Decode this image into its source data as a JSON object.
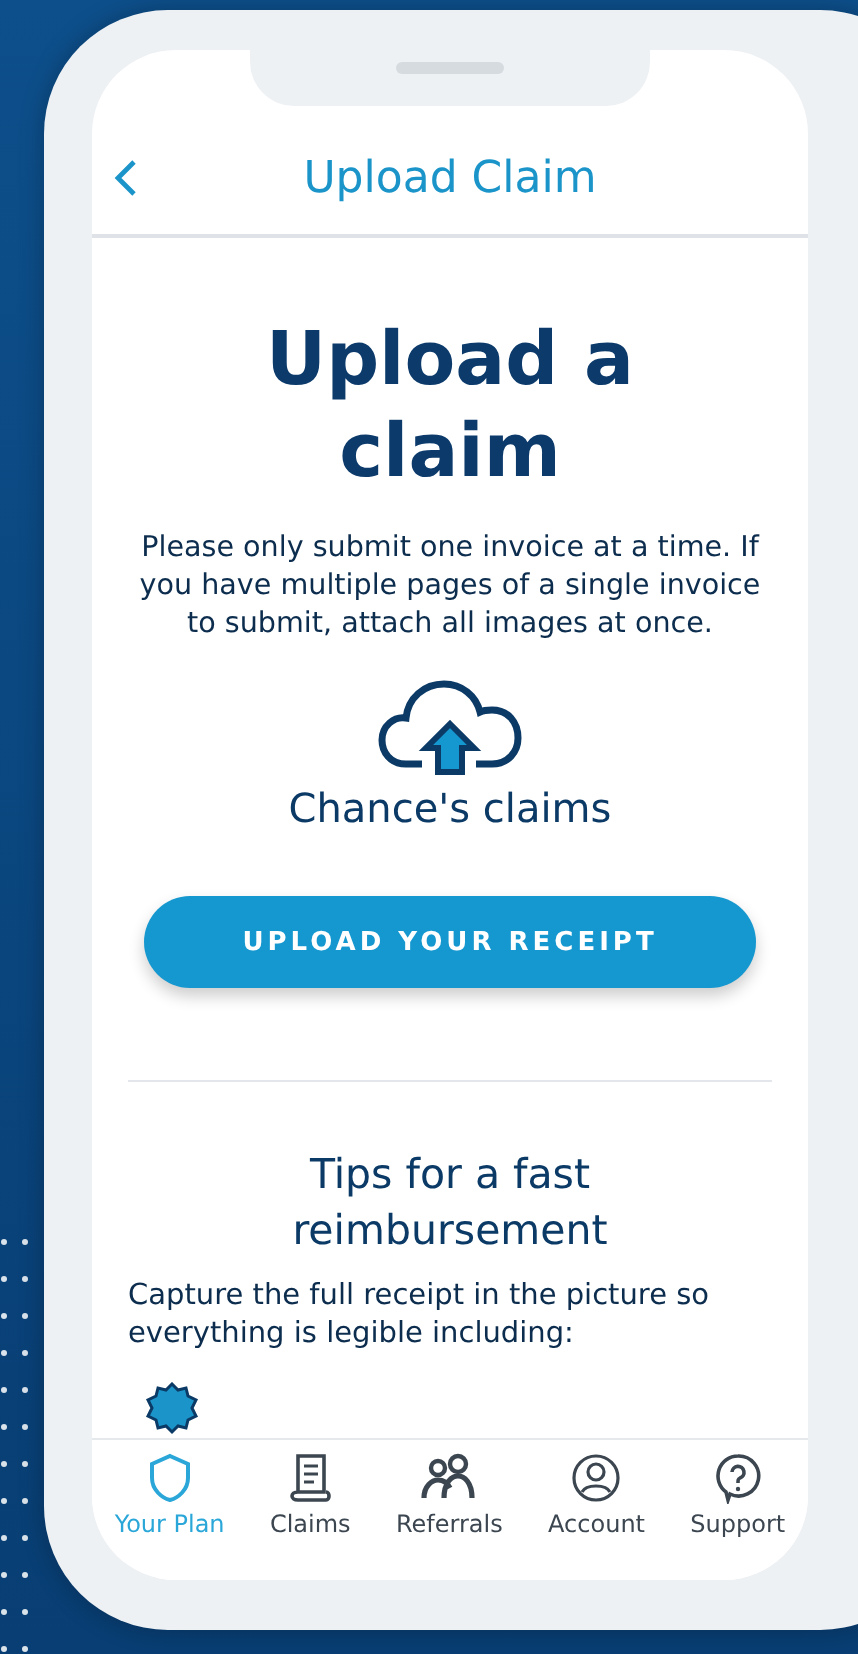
{
  "header": {
    "title": "Upload Claim"
  },
  "heading": "Upload a claim",
  "intro": "Please only submit one invoice at a time. If you have multiple pages of a single invoice to submit, attach all images at once.",
  "claims_owner": "Chance's claims",
  "upload_button": "UPLOAD YOUR RECEIPT",
  "tips": {
    "title": "Tips for a fast reimbursement",
    "text": "Capture the full receipt in the picture so everything is legible including:"
  },
  "tab_bar": [
    {
      "label": "Your Plan",
      "kind": "plan",
      "selected": true
    },
    {
      "label": "Claims",
      "kind": "claims",
      "selected": false
    },
    {
      "label": "Referrals",
      "kind": "referrals",
      "selected": false
    },
    {
      "label": "Account",
      "kind": "account",
      "selected": false
    },
    {
      "label": "Support",
      "kind": "support",
      "selected": false
    }
  ]
}
